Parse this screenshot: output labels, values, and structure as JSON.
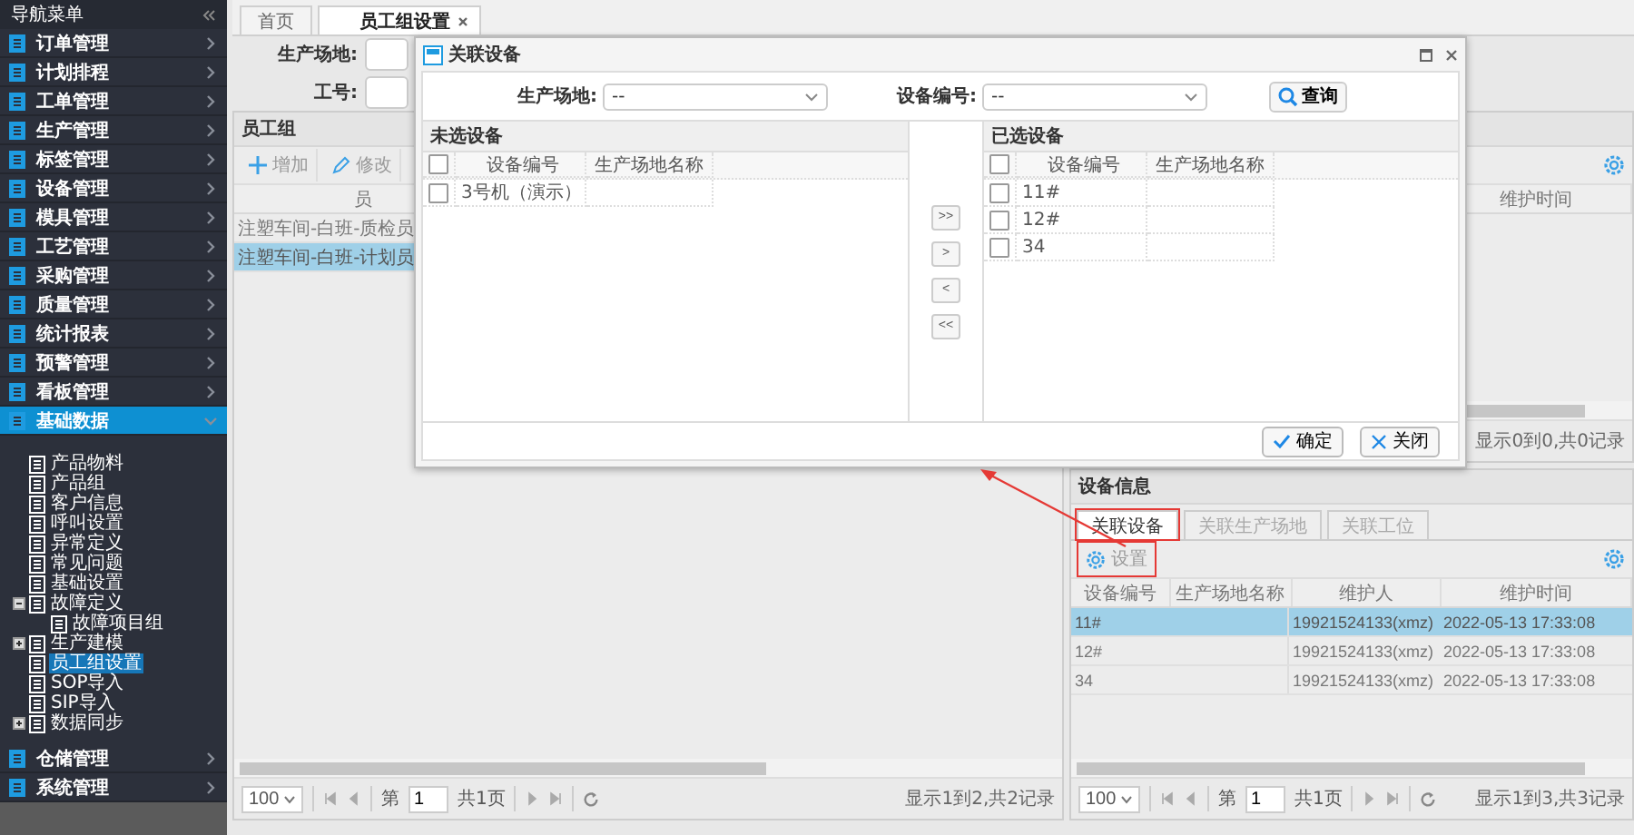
{
  "sidebar": {
    "title": "导航菜单",
    "menu": [
      {
        "label": "订单管理",
        "expanded": false,
        "selected": false
      },
      {
        "label": "计划排程",
        "expanded": false,
        "selected": false
      },
      {
        "label": "工单管理",
        "expanded": false,
        "selected": false
      },
      {
        "label": "生产管理",
        "expanded": false,
        "selected": false
      },
      {
        "label": "标签管理",
        "expanded": false,
        "selected": false
      },
      {
        "label": "设备管理",
        "expanded": false,
        "selected": false
      },
      {
        "label": "模具管理",
        "expanded": false,
        "selected": false
      },
      {
        "label": "工艺管理",
        "expanded": false,
        "selected": false
      },
      {
        "label": "采购管理",
        "expanded": false,
        "selected": false
      },
      {
        "label": "质量管理",
        "expanded": false,
        "selected": false
      },
      {
        "label": "统计报表",
        "expanded": false,
        "selected": false
      },
      {
        "label": "预警管理",
        "expanded": false,
        "selected": false
      },
      {
        "label": "看板管理",
        "expanded": false,
        "selected": false
      },
      {
        "label": "基础数据",
        "expanded": true,
        "selected": true,
        "children": [
          {
            "label": "产品物料",
            "selected": false
          },
          {
            "label": "产品组",
            "selected": false
          },
          {
            "label": "客户信息",
            "selected": false
          },
          {
            "label": "呼叫设置",
            "selected": false
          },
          {
            "label": "异常定义",
            "selected": false
          },
          {
            "label": "常见问题",
            "selected": false
          },
          {
            "label": "基础设置",
            "selected": false
          },
          {
            "label": "故障定义",
            "selected": false,
            "expanded": true,
            "children": [
              {
                "label": "故障项目组",
                "selected": false
              }
            ]
          },
          {
            "label": "生产建模",
            "selected": false,
            "expanded": false
          },
          {
            "label": "员工组设置",
            "selected": true
          },
          {
            "label": "SOP导入",
            "selected": false
          },
          {
            "label": "SIP导入",
            "selected": false
          },
          {
            "label": "数据同步",
            "selected": false,
            "expanded": false
          }
        ]
      },
      {
        "label": "仓储管理",
        "expanded": false,
        "selected": false
      },
      {
        "label": "系统管理",
        "expanded": false,
        "selected": false
      }
    ]
  },
  "tabs": [
    {
      "label": "首页",
      "selected": false,
      "closable": false
    },
    {
      "label": "员工组设置",
      "selected": true,
      "closable": true
    }
  ],
  "form": {
    "fields": [
      {
        "label": "生产场地:"
      },
      {
        "label": "工号:"
      }
    ]
  },
  "employee_groups": {
    "title": "员工组",
    "toolbar": [
      {
        "label": "增加",
        "kind": "add"
      },
      {
        "label": "修改",
        "kind": "edit"
      }
    ],
    "column": "员",
    "rows": [
      {
        "name": "注塑车间-白班-质检员",
        "selected": false
      },
      {
        "name": "注塑车间-白班-计划员",
        "selected": true
      }
    ],
    "pager": {
      "page_size": "100",
      "page_label": "第",
      "page": "1",
      "total_pages": "共1页",
      "summary": "显示1到2,共2记录"
    }
  },
  "maintenance": {
    "column": "维护时间",
    "summary": "显示0到0,共0记录"
  },
  "device_info": {
    "title": "设备信息",
    "tabs": [
      {
        "label": "关联设备",
        "selected": true,
        "highlighted": true
      },
      {
        "label": "关联生产场地",
        "selected": false,
        "highlighted": false
      },
      {
        "label": "关联工位",
        "selected": false,
        "highlighted": false
      }
    ],
    "settings_button": {
      "label": "设置",
      "highlighted": true
    },
    "columns": [
      "设备编号",
      "生产场地名称",
      "维护人",
      "维护时间"
    ],
    "rows": [
      {
        "device_no": "11#",
        "maintainer": "19921524133(xmz)",
        "time": "2022-05-13 17:33:08",
        "selected": true
      },
      {
        "device_no": "12#",
        "maintainer": "19921524133(xmz)",
        "time": "2022-05-13 17:33:08",
        "selected": false
      },
      {
        "device_no": "34",
        "maintainer": "19921524133(xmz)",
        "time": "2022-05-13 17:33:08",
        "selected": false
      }
    ],
    "pager": {
      "page_size": "100",
      "page_label": "第",
      "page": "1",
      "total_pages": "共1页",
      "summary": "显示1到3,共3记录"
    }
  },
  "dialog": {
    "title": "关联设备",
    "filters": [
      {
        "label": "生产场地:",
        "value": "--"
      },
      {
        "label": "设备编号:",
        "value": "--"
      }
    ],
    "search_button": "查询",
    "panes": [
      {
        "title": "未选设备",
        "header_checked": false,
        "columns": [
          "设备编号",
          "生产场地名称"
        ],
        "rows": [
          {
            "device_no": "3号机（演示）",
            "checked": false
          }
        ]
      },
      {
        "title": "已选设备",
        "header_checked": false,
        "columns": [
          "设备编号",
          "生产场地名称"
        ],
        "rows": [
          {
            "device_no": "11#",
            "checked": false
          },
          {
            "device_no": "12#",
            "checked": false
          },
          {
            "device_no": "34",
            "checked": false
          }
        ]
      }
    ],
    "transfer_buttons": [
      ">>",
      ">",
      "<",
      "<<"
    ],
    "buttons": [
      {
        "label": "确定",
        "kind": "confirm"
      },
      {
        "label": "关闭",
        "kind": "close"
      }
    ]
  }
}
